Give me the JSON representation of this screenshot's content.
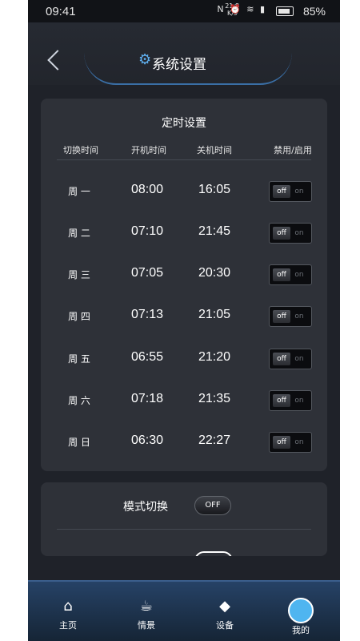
{
  "statusbar": {
    "time": "09:41",
    "speed": "21.8\nK/s",
    "battery": "85%"
  },
  "header": {
    "title": "系统设置"
  },
  "schedule": {
    "title": "定时设置",
    "columns": [
      "切换时间",
      "开机时间",
      "关机时间",
      "禁用/启用"
    ],
    "rows": [
      {
        "day": "周 一",
        "on": "08:00",
        "off": "16:05"
      },
      {
        "day": "周 二",
        "on": "07:10",
        "off": "21:45"
      },
      {
        "day": "周 三",
        "on": "07:05",
        "off": "20:30"
      },
      {
        "day": "周 四",
        "on": "07:13",
        "off": "21:05"
      },
      {
        "day": "周 五",
        "on": "06:55",
        "off": "21:20"
      },
      {
        "day": "周 六",
        "on": "07:18",
        "off": "21:35"
      },
      {
        "day": "周 日",
        "on": "06:30",
        "off": "22:27"
      }
    ],
    "switch": {
      "off": "off",
      "on": "on"
    }
  },
  "mode": {
    "label": "模式切换",
    "state": "OFF"
  },
  "tabs": [
    {
      "label": "主页",
      "icon": "home-icon"
    },
    {
      "label": "情景",
      "icon": "cup-icon"
    },
    {
      "label": "设备",
      "icon": "layers-icon"
    },
    {
      "label": "我的",
      "icon": "avatar-icon"
    }
  ],
  "colors": {
    "accent": "#4fb5f0",
    "bg": "#1f2229",
    "card": "#2e3138"
  }
}
